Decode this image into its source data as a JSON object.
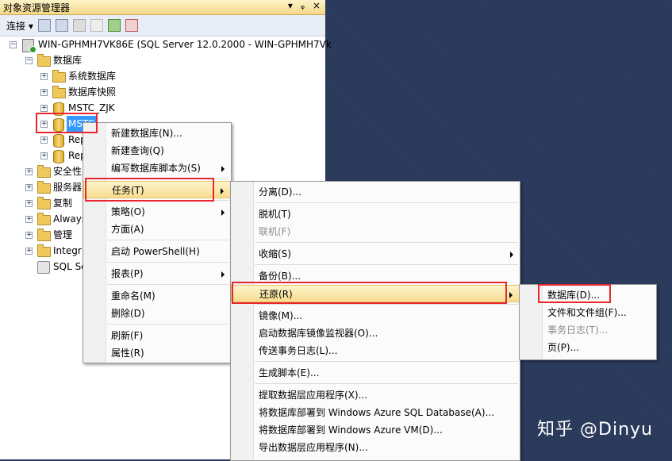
{
  "panel": {
    "title": "对象资源管理器",
    "title_buttons": [
      "▾",
      "ᵩ",
      "×"
    ],
    "connect_label": "连接",
    "connect_arrow": "▾"
  },
  "tree": {
    "server": "WIN-GPHMH7VK86E (SQL Server 12.0.2000 - WIN-GPHMH7Vk",
    "databases": "数据库",
    "system_db": "系统数据库",
    "snapshots": "数据库快照",
    "db1": "MSTC_ZJK",
    "db2": "MSTC",
    "db3": "Rep",
    "db4": "Rep",
    "security": "安全性",
    "server_objects": "服务器",
    "replication": "复制",
    "always_on": "Always",
    "management": "管理",
    "integration": "Integr",
    "sql_agent": "SQL Se"
  },
  "context_menu": {
    "items": [
      "新建数据库(N)...",
      "新建查询(Q)",
      "编写数据库脚本为(S)",
      "任务(T)",
      "策略(O)",
      "方面(A)",
      "启动 PowerShell(H)",
      "报表(P)",
      "重命名(M)",
      "删除(D)",
      "刷新(F)",
      "属性(R)"
    ]
  },
  "tasks_menu": {
    "items": [
      "分离(D)...",
      "脱机(T)",
      "联机(F)",
      "收缩(S)",
      "备份(B)...",
      "还原(R)",
      "镜像(M)...",
      "启动数据库镜像监视器(O)...",
      "传送事务日志(L)...",
      "生成脚本(E)...",
      "提取数据层应用程序(X)...",
      "将数据库部署到 Windows Azure SQL Database(A)...",
      "将数据库部署到 Windows Azure VM(D)...",
      "导出数据层应用程序(N)..."
    ]
  },
  "restore_menu": {
    "items": [
      "数据库(D)...",
      "文件和文件组(F)...",
      "事务日志(T)...",
      "页(P)..."
    ]
  },
  "watermark": "知乎 @Dinyu",
  "colors": {
    "highlight": "#f9dd8f",
    "annotation_red": "#e8262e",
    "selection": "#3399ff",
    "desktop": "#2b3a5c"
  }
}
